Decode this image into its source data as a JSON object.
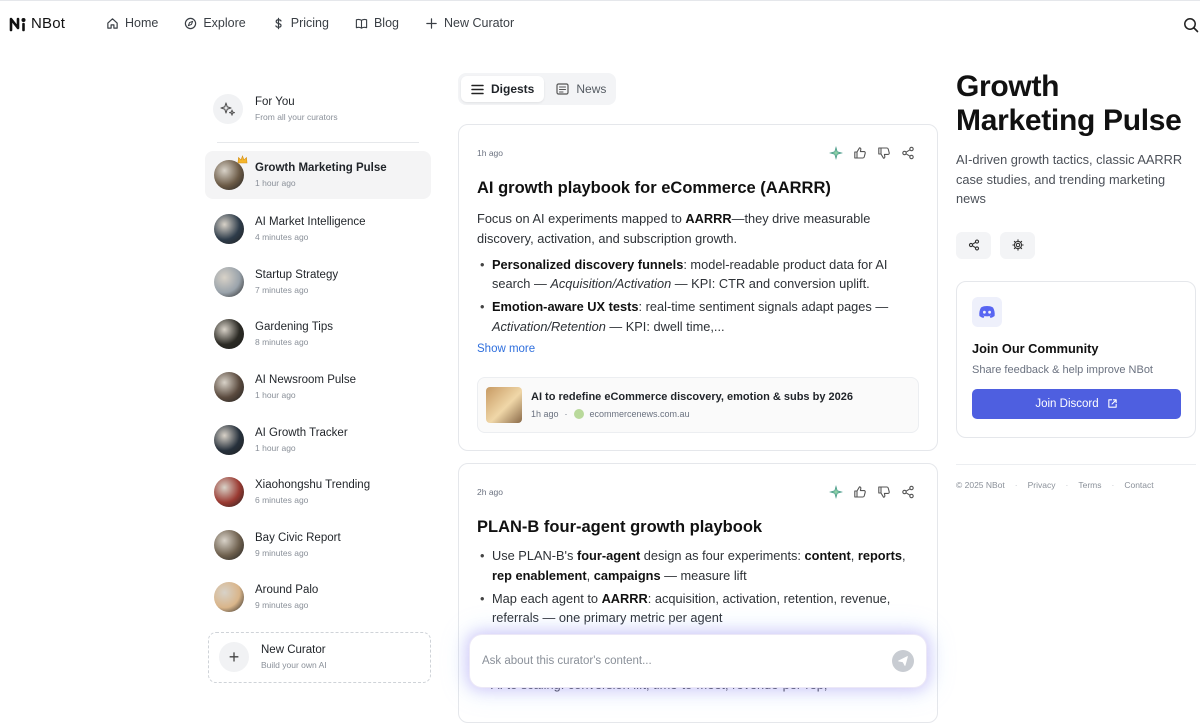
{
  "brand": {
    "name": "NBot"
  },
  "nav": [
    {
      "label": "Home",
      "icon": "home-icon"
    },
    {
      "label": "Explore",
      "icon": "compass-icon"
    },
    {
      "label": "Pricing",
      "icon": "dollar-icon"
    },
    {
      "label": "Blog",
      "icon": "book-icon"
    },
    {
      "label": "New Curator",
      "icon": "plus-icon"
    }
  ],
  "sidebar": {
    "for_you": {
      "title": "For You",
      "subtitle": "From all your curators"
    },
    "curators": [
      {
        "title": "Growth Marketing Pulse",
        "time": "1 hour ago",
        "active": true,
        "color": "#6b5a46"
      },
      {
        "title": "AI Market Intelligence",
        "time": "4 minutes ago",
        "color": "#2e3c4a"
      },
      {
        "title": "Startup Strategy",
        "time": "7 minutes ago",
        "color": "#9aa3ab"
      },
      {
        "title": "Gardening Tips",
        "time": "8 minutes ago",
        "color": "#2b2a24"
      },
      {
        "title": "AI Newsroom Pulse",
        "time": "1 hour ago",
        "color": "#5a4a3e"
      },
      {
        "title": "AI Growth Tracker",
        "time": "1 hour ago",
        "color": "#27313c"
      },
      {
        "title": "Xiaohongshu Trending",
        "time": "6 minutes ago",
        "color": "#9a3a32"
      },
      {
        "title": "Bay Civic Report",
        "time": "9 minutes ago",
        "color": "#6e604e"
      },
      {
        "title": "Around Palo",
        "time": "9 minutes ago",
        "color": "#d9b58a"
      }
    ],
    "new_curator": {
      "title": "New Curator",
      "subtitle": "Build your own AI"
    }
  },
  "tabs": [
    {
      "label": "Digests",
      "active": true
    },
    {
      "label": "News",
      "active": false
    }
  ],
  "cards": [
    {
      "time": "1h ago",
      "title": "AI growth playbook for eCommerce (AARRR)",
      "intro_a": "Focus on AI experiments mapped to ",
      "intro_b": "AARRR",
      "intro_c": "—they drive measurable discovery, activation, and subscription growth.",
      "b1_bold": "Personalized discovery funnels",
      "b1_text": ": model-readable product data for AI search — ",
      "b1_ital": "Acquisition/Activation",
      "b1_tail": " — KPI: CTR and conversion uplift.",
      "b2_bold": "Emotion-aware UX tests",
      "b2_text": ": real-time sentiment signals adapt pages — ",
      "b2_ital": "Activation/Retention",
      "b2_tail": " — KPI: dwell time,...",
      "show_more": "Show more",
      "source": {
        "title": "AI to redefine eCommerce discovery, emotion & subs by 2026",
        "time": "1h ago",
        "sep": "·",
        "domain": "ecommercenews.com.au"
      }
    },
    {
      "time": "2h ago",
      "title": "PLAN-B four-agent growth playbook",
      "b1_a": "Use PLAN-B's ",
      "b1_b": "four-agent",
      "b1_c": " design as four experiments: ",
      "b1_d": "content",
      "b1_e": ", ",
      "b1_f": "reports",
      "b1_g": ", ",
      "b1_h": "rep enablement",
      "b1_i": ", ",
      "b1_j": "campaigns",
      "b1_k": " — measure lift",
      "b2_a": "Map each agent to ",
      "b2_b": "AARRR",
      "b2_c": ": acquisition, activation, retention, revenue, referrals — one primary metric per agent",
      "cut": "AI to scaling: conversion lift, time-to-meet, revenue-per-rep,"
    }
  ],
  "right_panel": {
    "title": "Growth Marketing Pulse",
    "description": "AI-driven growth tactics, classic AARRR case studies, and trending marketing news",
    "community": {
      "title": "Join Our Community",
      "subtitle": "Share feedback & help improve NBot",
      "button": "Join Discord"
    },
    "footer": {
      "copyright": "© 2025 NBot",
      "links": [
        "Privacy",
        "Terms",
        "Contact"
      ],
      "sep": "·"
    }
  },
  "ask": {
    "placeholder": "Ask about this curator's content..."
  },
  "colors": {
    "accent": "#4e5fe0",
    "link": "#2f6fdd"
  }
}
